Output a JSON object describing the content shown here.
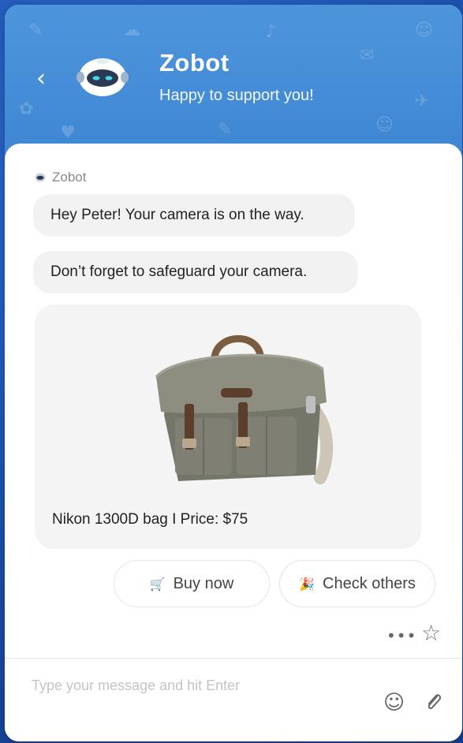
{
  "header": {
    "bot_name": "Zobot",
    "tagline": "Happy to support you!",
    "back_icon": "chevron-left-icon",
    "bg_color": "#4d95db"
  },
  "chat": {
    "sender": "Zobot",
    "messages": [
      "Hey Peter! Your camera is on the way.",
      "Don’t forget to safeguard your camera."
    ],
    "product_card": {
      "caption": "Nikon 1300D bag I Price: $75"
    },
    "actions": {
      "buy_label": "Buy now",
      "buy_icon": "cart-icon",
      "other_label": "Check others",
      "other_icon": "party-popper-icon"
    },
    "more_icon": "ellipsis-icon",
    "rate_icon": "star-icon"
  },
  "composer": {
    "placeholder": "Type your message and hit Enter",
    "emoji_icon": "smiley-icon",
    "attach_icon": "paperclip-icon"
  }
}
